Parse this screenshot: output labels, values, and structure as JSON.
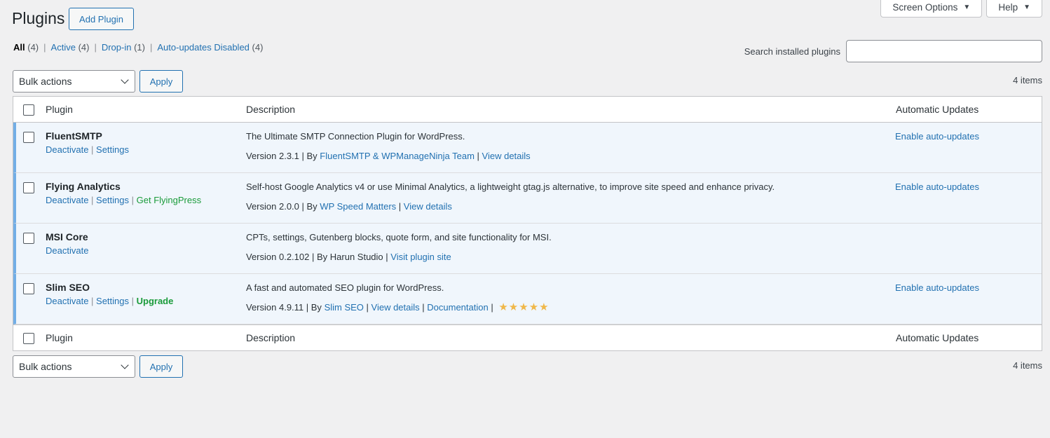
{
  "top_tabs": {
    "screen_options": "Screen Options",
    "help": "Help"
  },
  "page": {
    "title": "Plugins",
    "add_button": "Add Plugin"
  },
  "filters": [
    {
      "label": "All",
      "count": "(4)"
    },
    {
      "label": "Active",
      "count": "(4)"
    },
    {
      "label": "Drop-in",
      "count": "(1)"
    },
    {
      "label": "Auto-updates Disabled",
      "count": "(4)"
    }
  ],
  "filter_separator": "|",
  "search": {
    "label": "Search installed plugins",
    "value": ""
  },
  "tablenav": {
    "bulk_label": "Bulk actions",
    "apply_label": "Apply",
    "items_count": "4 items"
  },
  "columns": {
    "plugin": "Plugin",
    "description": "Description",
    "auto_updates": "Automatic Updates"
  },
  "plugins": [
    {
      "name": "FluentSMTP",
      "actions": [
        "Deactivate",
        "Settings"
      ],
      "description": "The Ultimate SMTP Connection Plugin for WordPress.",
      "version": "Version 2.3.1",
      "by_label": "By",
      "author": "FluentSMTP & WPManageNinja Team",
      "links": [
        "View details"
      ],
      "auto_update": "Enable auto-updates"
    },
    {
      "name": "Flying Analytics",
      "actions": [
        "Deactivate",
        "Settings",
        "Get FlyingPress"
      ],
      "description": "Self-host Google Analytics v4 or use Minimal Analytics, a lightweight gtag.js alternative, to improve site speed and enhance privacy.",
      "version": "Version 2.0.0",
      "by_label": "By",
      "author": "WP Speed Matters",
      "links": [
        "View details"
      ],
      "auto_update": "Enable auto-updates"
    },
    {
      "name": "MSI Core",
      "actions": [
        "Deactivate"
      ],
      "description": "CPTs, settings, Gutenberg blocks, quote form, and site functionality for MSI.",
      "version": "Version 0.2.102",
      "by_label": "By",
      "author": "Harun Studio",
      "links": [
        "Visit plugin site"
      ],
      "auto_update": ""
    },
    {
      "name": "Slim SEO",
      "actions": [
        "Deactivate",
        "Settings",
        "Upgrade"
      ],
      "description": "A fast and automated SEO plugin for WordPress.",
      "version": "Version 4.9.11",
      "by_label": "By",
      "author": "Slim SEO",
      "links": [
        "View details",
        "Documentation"
      ],
      "rating_stars": 5,
      "auto_update": "Enable auto-updates"
    }
  ],
  "colors": {
    "link": "#2271b1",
    "active_row_bg": "#f0f6fc",
    "active_row_border": "#72aee6",
    "promo_green": "#1a9b3a",
    "star": "#f0b849"
  }
}
